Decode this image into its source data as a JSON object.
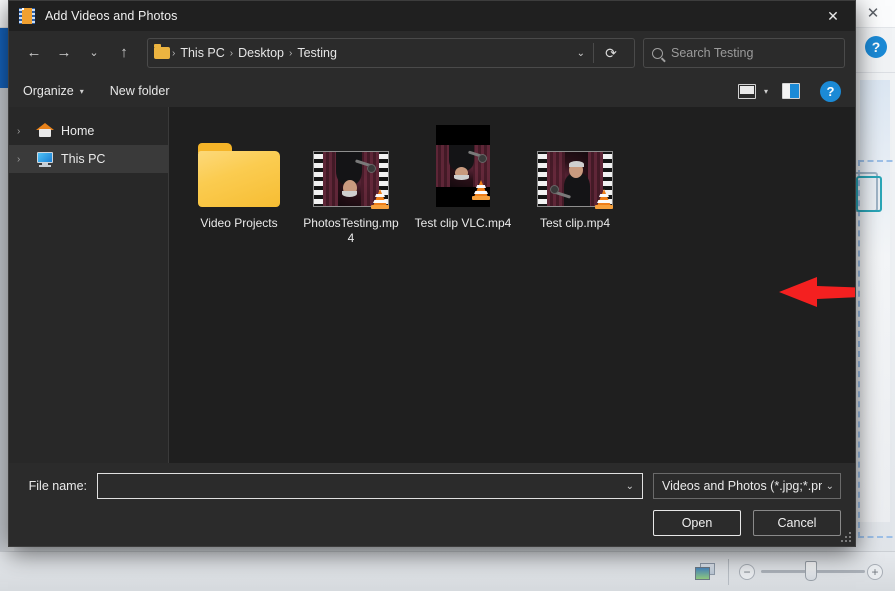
{
  "background_app": {
    "close_label": "✕",
    "collapse_label": "⌃",
    "help_label": "?",
    "zoom_minus_label": "−",
    "zoom_plus_label": "+",
    "view_icon": "image-thumbnail-icon",
    "accent_color": "#1565c0",
    "dashed_border_color": "#9dc0e8"
  },
  "dialog": {
    "title": "Add Videos and Photos",
    "icon": "film-strip-icon",
    "close_label": "✕",
    "nav": {
      "back_label": "←",
      "forward_label": "→",
      "recent_label": "⌄",
      "up_label": "↑",
      "refresh_label": "⟳",
      "folder_icon": "folder-icon",
      "breadcrumb": [
        "This PC",
        "Desktop",
        "Testing"
      ],
      "breadcrumb_separator": "›",
      "breadcrumb_chevron": "⌄"
    },
    "search": {
      "placeholder": "Search Testing",
      "icon": "search-icon"
    },
    "commandbar": {
      "organize_label": "Organize",
      "organize_caret": "▾",
      "new_folder_label": "New folder",
      "view_icon": "layout-view-icon",
      "view_caret": "▾",
      "preview_pane_icon": "preview-pane-icon",
      "help_label": "?"
    },
    "sidebar": {
      "items": [
        {
          "label": "Home",
          "icon": "home-icon",
          "chevron": "›",
          "selected": false
        },
        {
          "label": "This PC",
          "icon": "monitor-icon",
          "chevron": "›",
          "selected": true
        }
      ]
    },
    "files": [
      {
        "name": "Video Projects",
        "type": "folder",
        "overlay": null
      },
      {
        "name": "PhotosTesting.mp4",
        "type": "video",
        "overlay": "vlc-icon"
      },
      {
        "name": "Test clip VLC.mp4",
        "type": "video-tall",
        "overlay": "vlc-icon"
      },
      {
        "name": "Test clip.mp4",
        "type": "video",
        "overlay": "vlc-icon"
      }
    ],
    "annotation": {
      "type": "arrow",
      "direction": "left",
      "color": "#f42020"
    },
    "footer": {
      "filename_label": "File name:",
      "filename_value": "",
      "filename_chevron": "⌄",
      "filter_value": "Videos and Photos (*.jpg;*.png;",
      "filter_chevron": "⌄",
      "open_label": "Open",
      "cancel_label": "Cancel"
    }
  }
}
